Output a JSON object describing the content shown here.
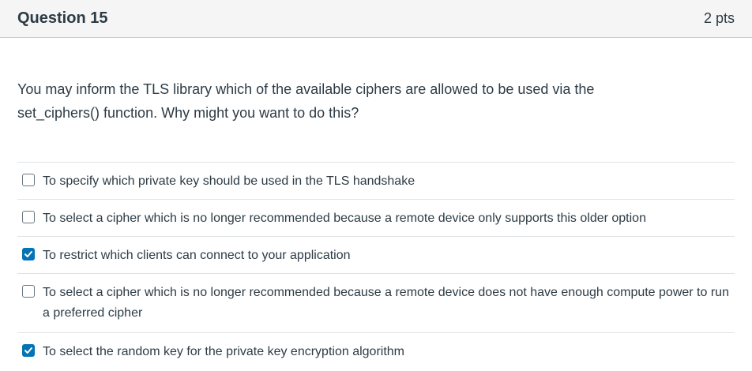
{
  "question": {
    "title": "Question 15",
    "points": "2 pts",
    "text": "You may inform the TLS library which of the available ciphers are allowed to be used via the set_ciphers() function. Why might you want to do this?"
  },
  "answers": [
    {
      "label": "To specify which private key should be used in the TLS handshake",
      "checked": false
    },
    {
      "label": "To select a cipher which is no longer recommended because a remote device only supports this older option",
      "checked": false
    },
    {
      "label": "To restrict which clients can connect to your application",
      "checked": true
    },
    {
      "label": "To select a cipher which is no longer recommended because a remote device does not have enough compute power to run a preferred cipher",
      "checked": false
    },
    {
      "label": "To select the random key for the private key encryption algorithm",
      "checked": true
    }
  ],
  "colors": {
    "checked": "#0374b5",
    "text": "#2d3b45",
    "header_bg": "#f5f5f5"
  }
}
